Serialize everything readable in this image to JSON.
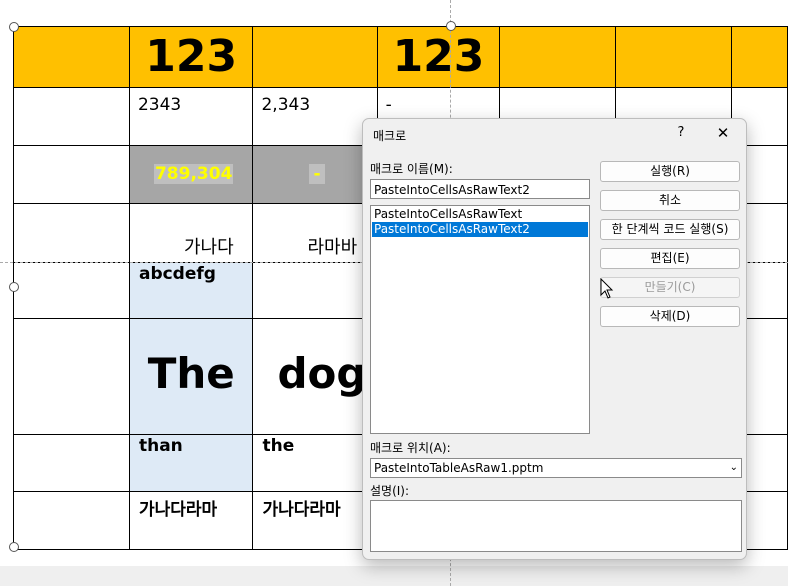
{
  "table": {
    "header_value": "123",
    "row2": {
      "c2": "2343",
      "c3": "2,343",
      "c4": "-"
    },
    "row3": {
      "c2": "789,304",
      "c3": "-"
    },
    "row4": {
      "c2": "가나다",
      "c3": "라마바"
    },
    "row5": {
      "c2": "abcdefg"
    },
    "row6": {
      "c2": "The",
      "c3": "dog"
    },
    "row7": {
      "c2": "than",
      "c3": "the"
    },
    "row8": {
      "c2": "가나다라마",
      "c3": "가나다라마"
    }
  },
  "dialog": {
    "title": "매크로",
    "help": "?",
    "close": "✕",
    "name_label": "매크로 이름(M):",
    "name_value": "PasteIntoCellsAsRawText2",
    "macros": [
      "PasteIntoCellsAsRawText",
      "PasteIntoCellsAsRawText2"
    ],
    "selected_index": 1,
    "location_label": "매크로 위치(A):",
    "location_value": "PasteIntoTableAsRaw1.pptm",
    "description_label": "설명(I):",
    "buttons": {
      "run": "실행(R)",
      "cancel": "취소",
      "step": "한 단계씩 코드 실행(S)",
      "edit": "편집(E)",
      "create": "만들기(C)",
      "delete": "삭제(D)"
    }
  },
  "colors": {
    "header_fill": "#ffc000",
    "gray_fill": "#a6a6a6",
    "blue_fill": "#deeaf6",
    "selection": "#0078d7",
    "yellow_text": "#ffff00"
  }
}
